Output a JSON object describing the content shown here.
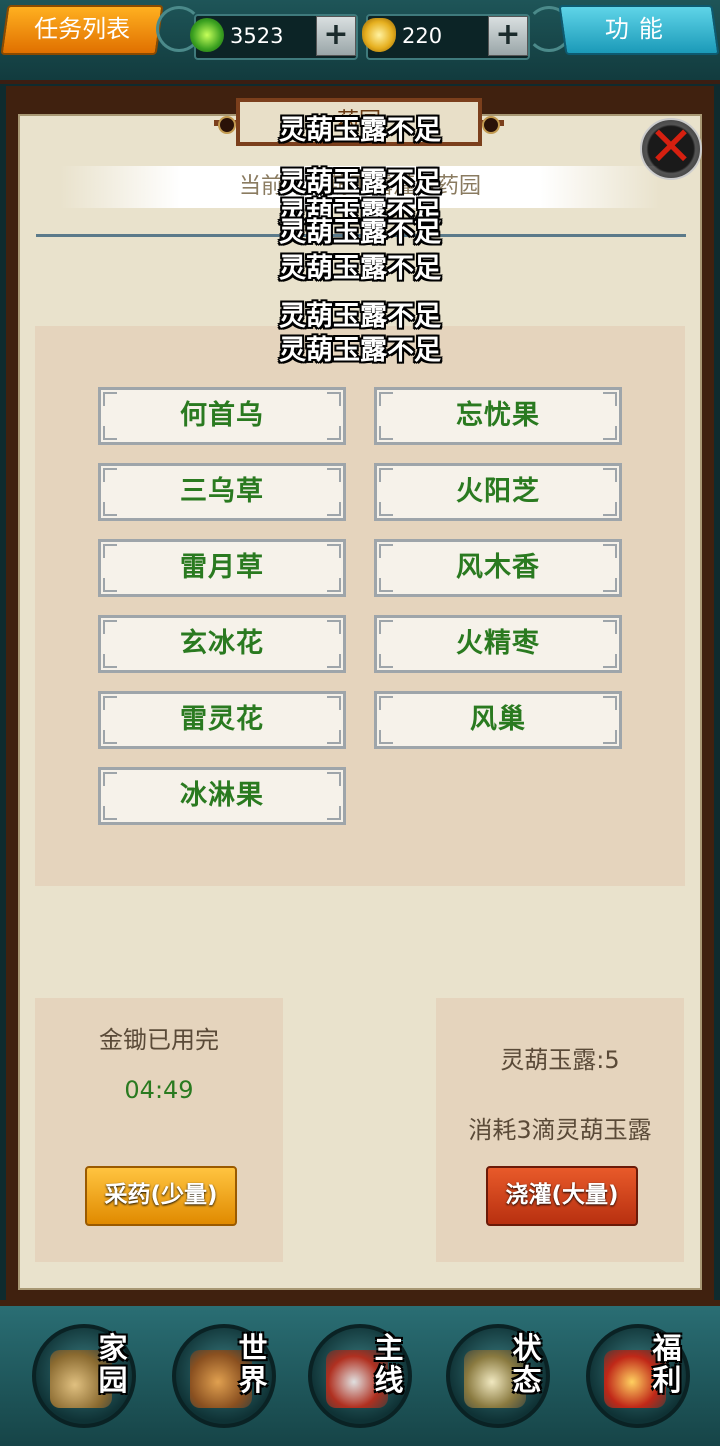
{
  "topbar": {
    "tasklist_label": "任务列表",
    "jade_value": "3523",
    "gold_value": "220",
    "plus_label": "+",
    "function_label": "功能"
  },
  "panel": {
    "title": "药园",
    "info_text": "当前为灵葫玉露灌溉药园",
    "close_label": "✕"
  },
  "floating_messages": [
    "灵葫玉露不足",
    "灵葫玉露不足",
    "灵葫玉露不足",
    "灵葫玉露不足",
    "灵葫玉露不足",
    "灵葫玉露不足",
    "灵葫玉露不足"
  ],
  "herbs": [
    "何首乌",
    "忘忧果",
    "三乌草",
    "火阳芝",
    "雷月草",
    "风木香",
    "玄冰花",
    "火精枣",
    "雷灵花",
    "风巢",
    "冰淋果"
  ],
  "left_box": {
    "status": "金锄已用完",
    "timer": "04:49",
    "button_label": "采药(少量)"
  },
  "right_box": {
    "dew_count": "灵葫玉露:5",
    "cost_text": "消耗3滴灵葫玉露",
    "button_label": "浇灌(大量)"
  },
  "nav": [
    {
      "label": "家园",
      "icon": "home-icon"
    },
    {
      "label": "世界",
      "icon": "world-map-icon"
    },
    {
      "label": "主线",
      "icon": "sword-icon"
    },
    {
      "label": "状态",
      "icon": "scroll-taiji-icon"
    },
    {
      "label": "福利",
      "icon": "treasure-bag-icon"
    }
  ],
  "colors": {
    "herb_text": "#2a7a20",
    "timer_text": "#2a7a20",
    "collect_button": "#e89a10",
    "water_button": "#c8401a"
  }
}
